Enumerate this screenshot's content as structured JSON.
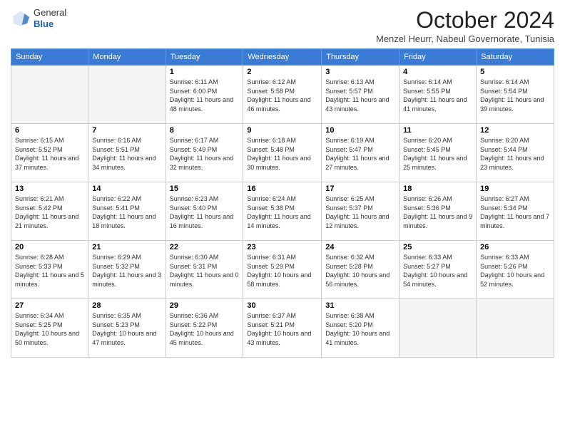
{
  "header": {
    "logo_line1": "General",
    "logo_line2": "Blue",
    "month": "October 2024",
    "location": "Menzel Heurr, Nabeul Governorate, Tunisia"
  },
  "days_of_week": [
    "Sunday",
    "Monday",
    "Tuesday",
    "Wednesday",
    "Thursday",
    "Friday",
    "Saturday"
  ],
  "weeks": [
    [
      {
        "num": "",
        "info": ""
      },
      {
        "num": "",
        "info": ""
      },
      {
        "num": "1",
        "info": "Sunrise: 6:11 AM\nSunset: 6:00 PM\nDaylight: 11 hours and 48 minutes."
      },
      {
        "num": "2",
        "info": "Sunrise: 6:12 AM\nSunset: 5:58 PM\nDaylight: 11 hours and 46 minutes."
      },
      {
        "num": "3",
        "info": "Sunrise: 6:13 AM\nSunset: 5:57 PM\nDaylight: 11 hours and 43 minutes."
      },
      {
        "num": "4",
        "info": "Sunrise: 6:14 AM\nSunset: 5:55 PM\nDaylight: 11 hours and 41 minutes."
      },
      {
        "num": "5",
        "info": "Sunrise: 6:14 AM\nSunset: 5:54 PM\nDaylight: 11 hours and 39 minutes."
      }
    ],
    [
      {
        "num": "6",
        "info": "Sunrise: 6:15 AM\nSunset: 5:52 PM\nDaylight: 11 hours and 37 minutes."
      },
      {
        "num": "7",
        "info": "Sunrise: 6:16 AM\nSunset: 5:51 PM\nDaylight: 11 hours and 34 minutes."
      },
      {
        "num": "8",
        "info": "Sunrise: 6:17 AM\nSunset: 5:49 PM\nDaylight: 11 hours and 32 minutes."
      },
      {
        "num": "9",
        "info": "Sunrise: 6:18 AM\nSunset: 5:48 PM\nDaylight: 11 hours and 30 minutes."
      },
      {
        "num": "10",
        "info": "Sunrise: 6:19 AM\nSunset: 5:47 PM\nDaylight: 11 hours and 27 minutes."
      },
      {
        "num": "11",
        "info": "Sunrise: 6:20 AM\nSunset: 5:45 PM\nDaylight: 11 hours and 25 minutes."
      },
      {
        "num": "12",
        "info": "Sunrise: 6:20 AM\nSunset: 5:44 PM\nDaylight: 11 hours and 23 minutes."
      }
    ],
    [
      {
        "num": "13",
        "info": "Sunrise: 6:21 AM\nSunset: 5:42 PM\nDaylight: 11 hours and 21 minutes."
      },
      {
        "num": "14",
        "info": "Sunrise: 6:22 AM\nSunset: 5:41 PM\nDaylight: 11 hours and 18 minutes."
      },
      {
        "num": "15",
        "info": "Sunrise: 6:23 AM\nSunset: 5:40 PM\nDaylight: 11 hours and 16 minutes."
      },
      {
        "num": "16",
        "info": "Sunrise: 6:24 AM\nSunset: 5:38 PM\nDaylight: 11 hours and 14 minutes."
      },
      {
        "num": "17",
        "info": "Sunrise: 6:25 AM\nSunset: 5:37 PM\nDaylight: 11 hours and 12 minutes."
      },
      {
        "num": "18",
        "info": "Sunrise: 6:26 AM\nSunset: 5:36 PM\nDaylight: 11 hours and 9 minutes."
      },
      {
        "num": "19",
        "info": "Sunrise: 6:27 AM\nSunset: 5:34 PM\nDaylight: 11 hours and 7 minutes."
      }
    ],
    [
      {
        "num": "20",
        "info": "Sunrise: 6:28 AM\nSunset: 5:33 PM\nDaylight: 11 hours and 5 minutes."
      },
      {
        "num": "21",
        "info": "Sunrise: 6:29 AM\nSunset: 5:32 PM\nDaylight: 11 hours and 3 minutes."
      },
      {
        "num": "22",
        "info": "Sunrise: 6:30 AM\nSunset: 5:31 PM\nDaylight: 11 hours and 0 minutes."
      },
      {
        "num": "23",
        "info": "Sunrise: 6:31 AM\nSunset: 5:29 PM\nDaylight: 10 hours and 58 minutes."
      },
      {
        "num": "24",
        "info": "Sunrise: 6:32 AM\nSunset: 5:28 PM\nDaylight: 10 hours and 56 minutes."
      },
      {
        "num": "25",
        "info": "Sunrise: 6:33 AM\nSunset: 5:27 PM\nDaylight: 10 hours and 54 minutes."
      },
      {
        "num": "26",
        "info": "Sunrise: 6:33 AM\nSunset: 5:26 PM\nDaylight: 10 hours and 52 minutes."
      }
    ],
    [
      {
        "num": "27",
        "info": "Sunrise: 6:34 AM\nSunset: 5:25 PM\nDaylight: 10 hours and 50 minutes."
      },
      {
        "num": "28",
        "info": "Sunrise: 6:35 AM\nSunset: 5:23 PM\nDaylight: 10 hours and 47 minutes."
      },
      {
        "num": "29",
        "info": "Sunrise: 6:36 AM\nSunset: 5:22 PM\nDaylight: 10 hours and 45 minutes."
      },
      {
        "num": "30",
        "info": "Sunrise: 6:37 AM\nSunset: 5:21 PM\nDaylight: 10 hours and 43 minutes."
      },
      {
        "num": "31",
        "info": "Sunrise: 6:38 AM\nSunset: 5:20 PM\nDaylight: 10 hours and 41 minutes."
      },
      {
        "num": "",
        "info": ""
      },
      {
        "num": "",
        "info": ""
      }
    ]
  ]
}
